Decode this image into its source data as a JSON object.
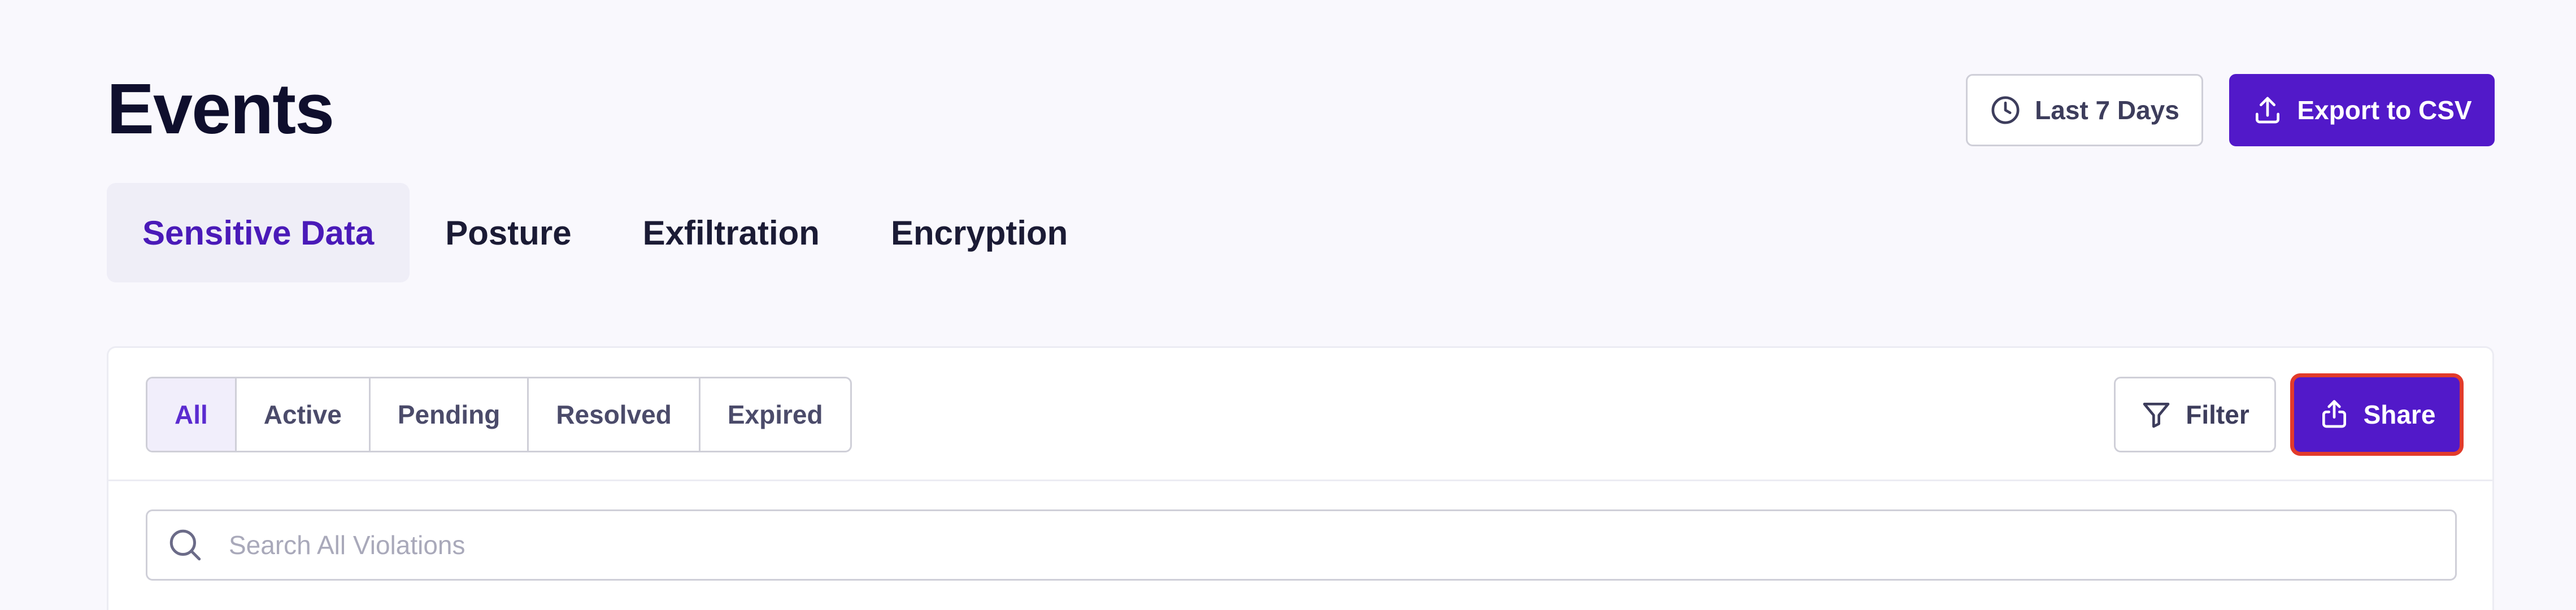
{
  "header": {
    "title": "Events",
    "date_range_label": "Last 7 Days",
    "export_label": "Export to CSV"
  },
  "tabs": [
    {
      "label": "Sensitive Data",
      "active": true
    },
    {
      "label": "Posture",
      "active": false
    },
    {
      "label": "Exfiltration",
      "active": false
    },
    {
      "label": "Encryption",
      "active": false
    }
  ],
  "status_filter": {
    "options": [
      "All",
      "Active",
      "Pending",
      "Resolved",
      "Expired"
    ],
    "selected": "All"
  },
  "toolbar": {
    "filter_label": "Filter",
    "share_label": "Share"
  },
  "search": {
    "placeholder": "Search All Violations",
    "value": ""
  },
  "colors": {
    "accent": "#5219c9",
    "active_tab_text": "#4a1ab8",
    "highlight_outline": "#e23b2b"
  },
  "icons": {
    "date_range": "clock-icon",
    "export": "upload-icon",
    "filter": "funnel-icon",
    "share": "share-upload-icon",
    "search": "search-icon"
  }
}
